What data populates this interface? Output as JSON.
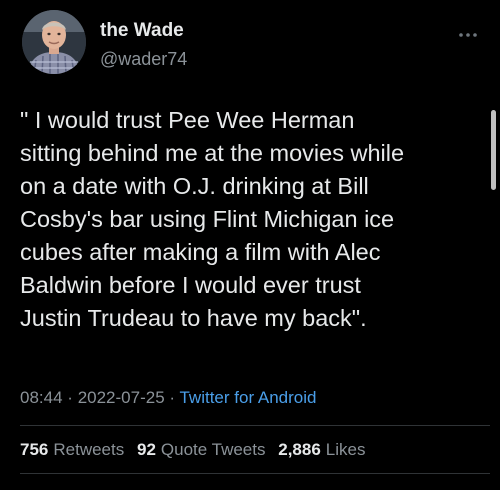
{
  "author": {
    "display_name": "the Wade",
    "handle": "@wader74",
    "avatar_icon": "profile-photo"
  },
  "tweet": {
    "text": "\" I would trust Pee Wee Herman\nsitting behind me at the movies while\non a date with O.J. drinking at Bill\nCosby's bar using Flint Michigan  ice\ncubes after making a film with Alec\nBaldwin before I would ever trust\nJustin Trudeau to have my back\".",
    "time": "08:44",
    "date": "2022-07-25",
    "source": "Twitter for Android",
    "separator": "·"
  },
  "stats": {
    "retweets": {
      "count": "756",
      "label": "Retweets"
    },
    "quote_tweets": {
      "count": "92",
      "label": "Quote Tweets"
    },
    "likes": {
      "count": "2,886",
      "label": "Likes"
    }
  },
  "icons": {
    "more": "more-dots-icon"
  },
  "colors": {
    "background": "#000000",
    "text_primary": "#e7e9ea",
    "text_secondary": "#8b9298",
    "link": "#4a9ee8",
    "divider": "#2f3336"
  }
}
